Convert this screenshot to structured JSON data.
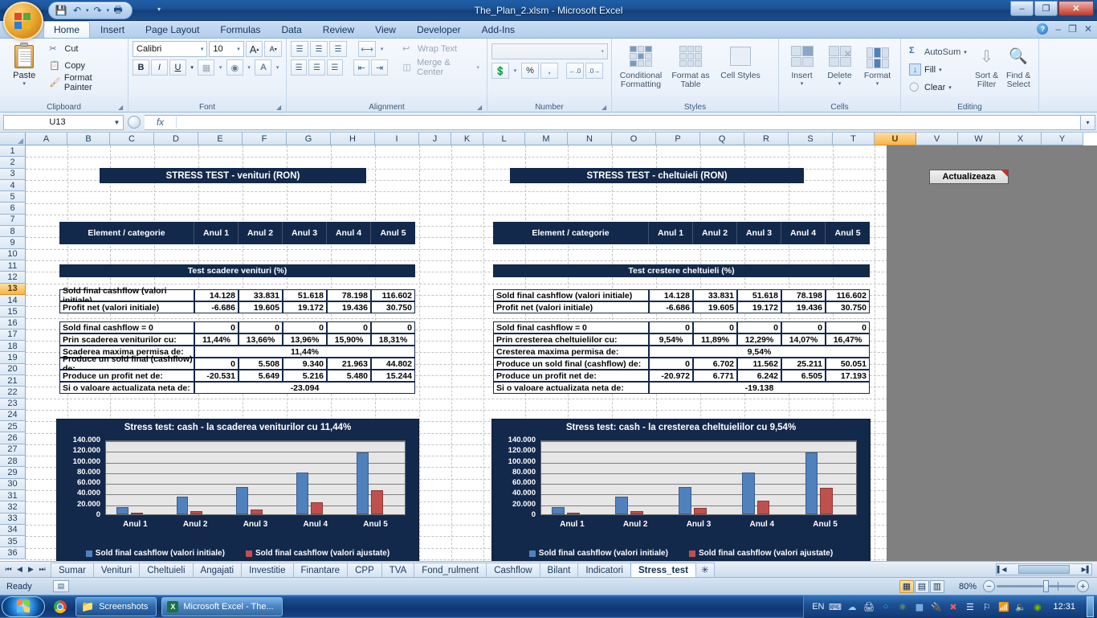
{
  "window": {
    "title": "The_Plan_2.xlsm - Microsoft Excel",
    "minimize": "–",
    "restore": "❐",
    "close": "✕"
  },
  "quick_access": {
    "save": "💾",
    "undo": "↶",
    "redo": "↷",
    "print_preview": "🖶",
    "customize": "▾"
  },
  "ribbon": {
    "tabs": [
      {
        "label": "Home",
        "active": true
      },
      {
        "label": "Insert",
        "active": false
      },
      {
        "label": "Page Layout",
        "active": false
      },
      {
        "label": "Formulas",
        "active": false
      },
      {
        "label": "Data",
        "active": false
      },
      {
        "label": "Review",
        "active": false
      },
      {
        "label": "View",
        "active": false
      },
      {
        "label": "Developer",
        "active": false
      },
      {
        "label": "Add-Ins",
        "active": false
      }
    ],
    "help_label": "?",
    "win_minimize": "–",
    "win_restore": "❐",
    "win_close": "✕",
    "groups": {
      "clipboard": {
        "name": "Clipboard",
        "paste": "Paste",
        "cut": "Cut",
        "copy": "Copy",
        "format_painter": "Format Painter"
      },
      "font": {
        "name": "Font",
        "font_family": "Calibri",
        "font_size": "10",
        "grow_font": "A",
        "shrink_font": "A",
        "bold": "B",
        "italic": "I",
        "underline": "U",
        "borders": "▦",
        "fill_color": "◆",
        "font_color": "A"
      },
      "alignment": {
        "name": "Alignment",
        "wrap_text": "Wrap Text",
        "merge_center": "Merge & Center",
        "align_top": "≡",
        "align_middle": "≡",
        "align_bottom": "≡",
        "orientation": "↱",
        "align_left": "≡",
        "align_center": "≡",
        "align_right": "≡",
        "decrease_indent": "⇤",
        "increase_indent": "⇥"
      },
      "number": {
        "name": "Number",
        "format_value": "",
        "accounting": "💰",
        "percent": "%",
        "comma": ",",
        "increase_decimal": ".00",
        "decrease_decimal": ".00"
      },
      "styles": {
        "name": "Styles",
        "conditional_formatting": "Conditional Formatting",
        "format_as_table": "Format as Table",
        "cell_styles": "Cell Styles"
      },
      "cells": {
        "name": "Cells",
        "insert": "Insert",
        "delete": "Delete",
        "format": "Format"
      },
      "editing": {
        "name": "Editing",
        "autosum": "AutoSum",
        "fill": "Fill",
        "clear": "Clear",
        "sort_filter": "Sort & Filter",
        "find_select": "Find & Select"
      }
    }
  },
  "formula_bar": {
    "name_box": "U13",
    "formula": "",
    "fx_label": "fx"
  },
  "grid": {
    "columns": [
      "A",
      "B",
      "C",
      "D",
      "E",
      "F",
      "G",
      "H",
      "I",
      "J",
      "K",
      "L",
      "M",
      "N",
      "O",
      "P",
      "Q",
      "R",
      "S",
      "T",
      "U",
      "V",
      "W",
      "X",
      "Y"
    ],
    "selected_column": "U",
    "selected_row": 13,
    "rows": [
      1,
      2,
      3,
      4,
      5,
      6,
      7,
      8,
      9,
      10,
      11,
      12,
      13,
      14,
      15,
      16,
      17,
      18,
      19,
      20,
      21,
      22,
      23,
      24,
      25,
      26,
      27,
      28,
      29,
      30,
      31,
      32,
      33,
      34,
      35,
      36
    ]
  },
  "macro_button": {
    "label": "Actualizeaza"
  },
  "left_panel": {
    "title": "STRESS TEST - venituri (RON)",
    "header": [
      "Element / categorie",
      "Anul 1",
      "Anul 2",
      "Anul 3",
      "Anul 4",
      "Anul 5"
    ],
    "section_banner": "Test scadere venituri (%)",
    "initial_rows": [
      {
        "label": "Sold final cashflow (valori initiale)",
        "values": [
          "14.128",
          "33.831",
          "51.618",
          "78.198",
          "116.602"
        ]
      },
      {
        "label": "Profit net (valori initiale)",
        "values": [
          "-6.686",
          "19.605",
          "19.172",
          "19.436",
          "30.750"
        ]
      }
    ],
    "test_rows": [
      {
        "label": "Sold final cashflow = 0",
        "values": [
          "0",
          "0",
          "0",
          "0",
          "0"
        ]
      },
      {
        "label": "Prin scaderea veniturilor cu:",
        "values": [
          "11,44%",
          "13,66%",
          "13,96%",
          "15,90%",
          "18,31%"
        ]
      }
    ],
    "max_row": {
      "label": "Scaderea maxima permisa de:",
      "value": "11,44%"
    },
    "result_rows": [
      {
        "label": "Produce un sold final (cashflow) de:",
        "values": [
          "0",
          "5.508",
          "9.340",
          "21.963",
          "44.802"
        ]
      },
      {
        "label": "Produce un profit net de:",
        "values": [
          "-20.531",
          "5.649",
          "5.216",
          "5.480",
          "15.244"
        ]
      }
    ],
    "npv_row": {
      "label": "Si o valoare actualizata neta de:",
      "value": "-23.094"
    }
  },
  "right_panel": {
    "title": "STRESS TEST - cheltuieli (RON)",
    "header": [
      "Element / categorie",
      "Anul 1",
      "Anul 2",
      "Anul 3",
      "Anul 4",
      "Anul 5"
    ],
    "section_banner": "Test crestere cheltuieli (%)",
    "initial_rows": [
      {
        "label": "Sold final cashflow (valori initiale)",
        "values": [
          "14.128",
          "33.831",
          "51.618",
          "78.198",
          "116.602"
        ]
      },
      {
        "label": "Profit net (valori initiale)",
        "values": [
          "-6.686",
          "19.605",
          "19.172",
          "19.436",
          "30.750"
        ]
      }
    ],
    "test_rows": [
      {
        "label": "Sold final cashflow = 0",
        "values": [
          "0",
          "0",
          "0",
          "0",
          "0"
        ]
      },
      {
        "label": "Prin cresterea cheltuielilor cu:",
        "values": [
          "9,54%",
          "11,89%",
          "12,29%",
          "14,07%",
          "16,47%"
        ]
      }
    ],
    "max_row": {
      "label": "Cresterea maxima permisa de:",
      "value": "9,54%"
    },
    "result_rows": [
      {
        "label": "Produce un sold final (cashflow) de:",
        "values": [
          "0",
          "6.702",
          "11.562",
          "25.211",
          "50.051"
        ]
      },
      {
        "label": "Produce un profit net de:",
        "values": [
          "-20.972",
          "6.771",
          "6.242",
          "6.505",
          "17.193"
        ]
      }
    ],
    "npv_row": {
      "label": "Si o valoare actualizata neta de:",
      "value": "-19.138"
    }
  },
  "chart_data": [
    {
      "type": "bar",
      "title": "Stress test: cash - la scaderea veniturilor cu 11,44%",
      "categories": [
        "Anul 1",
        "Anul 2",
        "Anul 3",
        "Anul 4",
        "Anul 5"
      ],
      "series": [
        {
          "name": "Sold final cashflow (valori initiale)",
          "color": "#4f81bd",
          "values": [
            14128,
            33831,
            51618,
            78198,
            116602
          ]
        },
        {
          "name": "Sold final cashflow (valori ajustate)",
          "color": "#c0504d",
          "values": [
            0,
            5508,
            9340,
            21963,
            44802
          ]
        }
      ],
      "ylim": [
        0,
        140000
      ],
      "yticks": [
        "0",
        "20.000",
        "40.000",
        "60.000",
        "80.000",
        "100.000",
        "120.000",
        "140.000"
      ],
      "xlabel": "",
      "ylabel": "",
      "grid": true,
      "legend": "bottom"
    },
    {
      "type": "bar",
      "title": "Stress test: cash - la cresterea cheltuielilor cu 9,54%",
      "categories": [
        "Anul 1",
        "Anul 2",
        "Anul 3",
        "Anul 4",
        "Anul 5"
      ],
      "series": [
        {
          "name": "Sold final cashflow (valori initiale)",
          "color": "#4f81bd",
          "values": [
            14128,
            33831,
            51618,
            78198,
            116602
          ]
        },
        {
          "name": "Sold final cashflow (valori ajustate)",
          "color": "#c0504d",
          "values": [
            0,
            6702,
            11562,
            25211,
            50051
          ]
        }
      ],
      "ylim": [
        0,
        140000
      ],
      "yticks": [
        "0",
        "20.000",
        "40.000",
        "60.000",
        "80.000",
        "100.000",
        "120.000",
        "140.000"
      ],
      "xlabel": "",
      "ylabel": "",
      "grid": true,
      "legend": "bottom"
    }
  ],
  "sheet_tabs": {
    "first": "⏮",
    "prev": "◀",
    "next": "▶",
    "last": "⏭",
    "items": [
      {
        "label": "Sumar",
        "active": false
      },
      {
        "label": "Venituri",
        "active": false
      },
      {
        "label": "Cheltuieli",
        "active": false
      },
      {
        "label": "Angajati",
        "active": false
      },
      {
        "label": "Investitie",
        "active": false
      },
      {
        "label": "Finantare",
        "active": false
      },
      {
        "label": "CPP",
        "active": false
      },
      {
        "label": "TVA",
        "active": false
      },
      {
        "label": "Fond_rulment",
        "active": false
      },
      {
        "label": "Cashflow",
        "active": false
      },
      {
        "label": "Bilant",
        "active": false
      },
      {
        "label": "Indicatori",
        "active": false
      },
      {
        "label": "Stress_test",
        "active": true
      }
    ],
    "insert_sheet": "✳"
  },
  "status_bar": {
    "status": "Ready",
    "zoom": "80%",
    "zoom_out": "−",
    "zoom_in": "+",
    "view_normal": "▦",
    "view_layout": "▤",
    "view_break": "▥"
  },
  "taskbar": {
    "buttons": [
      {
        "label": "Screenshots",
        "icon": "folder-icon"
      },
      {
        "label": "Microsoft Excel - The...",
        "icon": "excel-icon"
      }
    ],
    "tray": {
      "language": "EN",
      "clock": "12:31"
    }
  },
  "colors": {
    "navy": "#13294b",
    "series_blue": "#4f81bd",
    "series_red": "#c0504d",
    "plot_bg": "#e6e6e6",
    "accent_orange": "#f7b54a"
  }
}
